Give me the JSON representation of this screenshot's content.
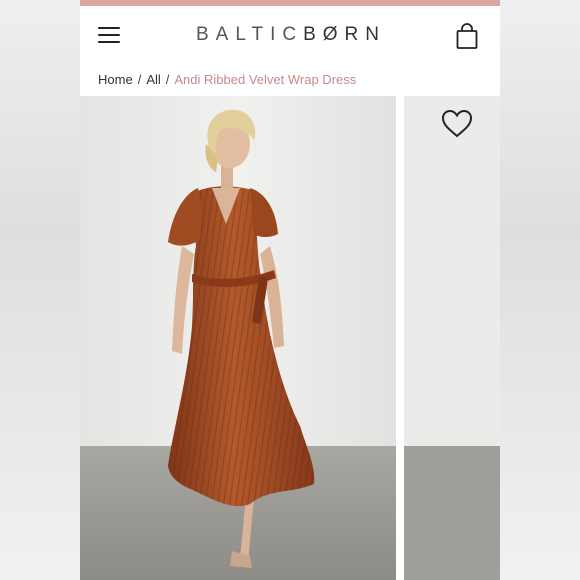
{
  "header": {
    "brand_prefix": "BALTIC",
    "brand_suffix": "BØRN",
    "menu_icon": "hamburger-menu-icon",
    "bag_icon": "shopping-bag-icon"
  },
  "breadcrumb": {
    "items": [
      "Home",
      "All"
    ],
    "separator": "/",
    "current": "Andi Ribbed Velvet Wrap Dress"
  },
  "product": {
    "wishlist_icon": "heart-icon"
  },
  "colors": {
    "accent_strip": "#d9a6a3",
    "breadcrumb_current": "#c7898a",
    "dress": "#a84e25"
  }
}
